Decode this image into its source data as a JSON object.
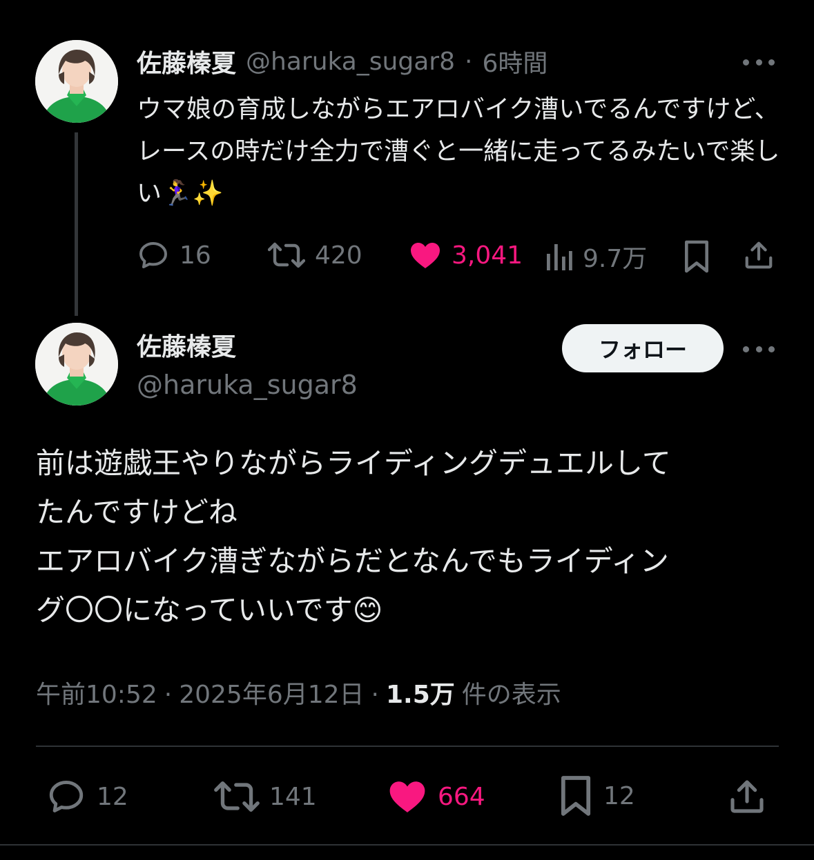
{
  "tweet1": {
    "author_name": "佐藤榛夏",
    "handle": "@haruka_sugar8",
    "separator": "·",
    "time_ago": "6時間",
    "text": "ウマ娘の育成しながらエアロバイク漕いでるんですけど、レースの時だけ全力で漕ぐと一緒に走ってるみたいで楽しい🏃‍♀️✨",
    "stats": {
      "replies": "16",
      "retweets": "420",
      "likes": "3,041",
      "views": "9.7万"
    }
  },
  "tweet2": {
    "author_name": "佐藤榛夏",
    "handle": "@haruka_sugar8",
    "follow_label": "フォロー",
    "text_lines": [
      "前は遊戯王やりながらライディングデュエルして",
      "たんですけどね",
      "エアロバイク漕ぎながらだとなんでもライディン",
      "グ〇〇になっていいです😊"
    ],
    "meta": {
      "time": "午前10:52",
      "dot1": "·",
      "date": "2025年6月12日",
      "dot2": "·",
      "views_count": "1.5万",
      "views_label": "件の表示"
    },
    "stats": {
      "replies": "12",
      "retweets": "141",
      "likes": "664",
      "bookmarks": "12"
    }
  },
  "colors": {
    "background": "#000000",
    "text": "#e7e9ea",
    "muted": "#71767b",
    "like": "#f91880"
  }
}
